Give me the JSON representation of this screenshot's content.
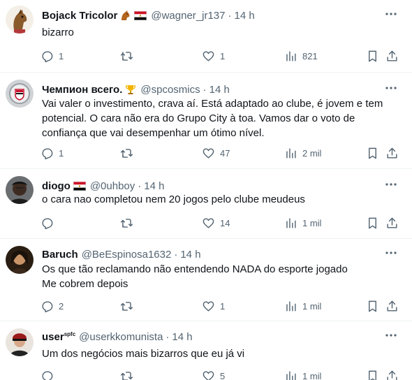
{
  "tweets": [
    {
      "name": "Bojack Tricolor",
      "badges": [
        "horse-emoji",
        "egypt-flag"
      ],
      "handle": "@wagner_jr137",
      "time": "14 h",
      "lines": [
        "bizarro"
      ],
      "replies": "1",
      "retweets": "",
      "likes": "1",
      "views": "821"
    },
    {
      "name": "Чемпион всего.",
      "badges": [
        "trophy-emoji"
      ],
      "handle": "@spcosmics",
      "time": "14 h",
      "lines": [
        "Vai valer o investimento, crava aí. Está adaptado ao clube, é jovem e tem",
        "potencial. O cara não era do Grupo City à toa. Vamos dar o voto de",
        "confiança que vai desempenhar um ótimo nível."
      ],
      "replies": "1",
      "retweets": "",
      "likes": "47",
      "views": "2 mil"
    },
    {
      "name": "diogo",
      "badges": [
        "egypt-flag"
      ],
      "handle": "@0uhboy",
      "time": "14 h",
      "lines": [
        "o cara nao completou nem 20 jogos pelo clube meudeus"
      ],
      "replies": "",
      "retweets": "",
      "likes": "14",
      "views": "1 mil"
    },
    {
      "name": "Baruch",
      "badges": [],
      "handle": "@BeEspinosa1632",
      "time": "14 h",
      "lines": [
        "Os que tão reclamando não entendendo NADA do esporte jogado",
        "Me cobrem depois"
      ],
      "replies": "2",
      "retweets": "",
      "likes": "1",
      "views": "1 mil"
    },
    {
      "name": "user",
      "name_sup": "spfc",
      "badges": [],
      "handle": "@userkkomunista",
      "time": "14 h",
      "lines": [
        "Um dos negócios mais bizarros que eu já vi"
      ],
      "replies": "",
      "retweets": "",
      "likes": "5",
      "views": "1 mil"
    }
  ],
  "separator": "·",
  "icons": {
    "reply": "reply-icon",
    "retweet": "retweet-icon",
    "like": "heart-icon",
    "views": "views-icon",
    "bookmark": "bookmark-icon",
    "share": "share-icon",
    "more": "more-icon"
  }
}
